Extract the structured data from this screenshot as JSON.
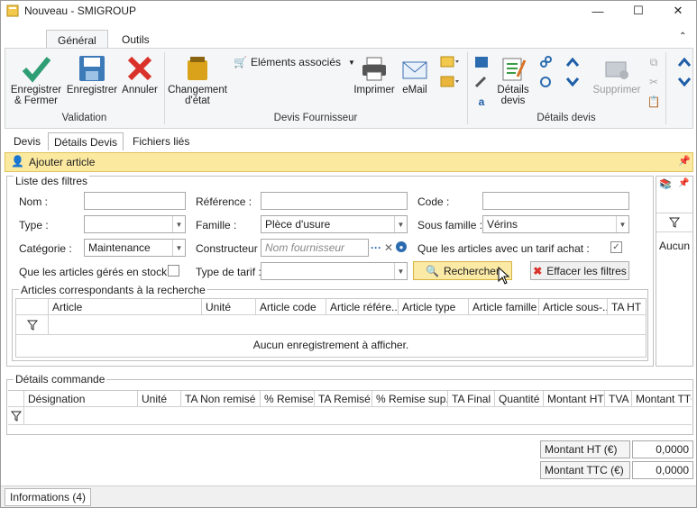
{
  "window": {
    "title": "Nouveau - SMIGROUP"
  },
  "ribbon_tabs": [
    "Général",
    "Outils"
  ],
  "ribbon": {
    "save_close": "Enregistrer & Fermer",
    "save": "Enregistrer",
    "cancel": "Annuler",
    "group_validation": "Validation",
    "change_state": "Changement d'état",
    "associated": "Eléments associés",
    "print": "Imprimer",
    "email": "eMail",
    "group_devis": "Devis Fournisseur",
    "details": "Détails devis",
    "delete": "Supprimer",
    "group_details": "Détails devis"
  },
  "doc_tabs": [
    "Devis",
    "Détails Devis",
    "Fichiers liés"
  ],
  "add_article": "Ajouter article",
  "filters": {
    "legend": "Liste des filtres",
    "nom_label": "Nom :",
    "nom_value": "",
    "reference_label": "Référence :",
    "reference_value": "",
    "code_label": "Code :",
    "code_value": "",
    "type_label": "Type :",
    "type_value": "",
    "famille_label": "Famille :",
    "famille_value": "Plèce d'usure",
    "sous_famille_label": "Sous famille :",
    "sous_famille_value": "Vérins",
    "categorie_label": "Catégorie :",
    "categorie_value": "Maintenance",
    "constructeur_label": "Constructeur :",
    "constructeur_placeholder": "Nom fournisseur",
    "tarif_achat_label": "Que les articles avec un tarif achat :",
    "stock_label": "Que les articles gérés en stock :",
    "type_tarif_label": "Type de tarif :",
    "type_tarif_value": "",
    "search_button": "Rechercher",
    "clear_button": "Effacer les filtres"
  },
  "results": {
    "legend": "Articles correspondants à la recherche",
    "columns": [
      "Article",
      "Unité",
      "Article code",
      "Article référe...",
      "Article type",
      "Article famille",
      "Article sous-...",
      "TA HT"
    ],
    "empty": "Aucun enregistrement à afficher."
  },
  "side_panel": {
    "text": "Aucun"
  },
  "order": {
    "legend": "Détails commande",
    "columns": [
      "Désignation",
      "Unité",
      "TA Non remisé",
      "% Remise",
      "TA Remisé",
      "% Remise sup.",
      "TA Final",
      "Quantité",
      "Montant HT",
      "TVA",
      "Montant TTC"
    ]
  },
  "totals": {
    "ht_label": "Montant HT (€)",
    "ht_value": "0,0000",
    "ttc_label": "Montant TTC (€)",
    "ttc_value": "0,0000"
  },
  "status": {
    "info": "Informations (4)"
  }
}
